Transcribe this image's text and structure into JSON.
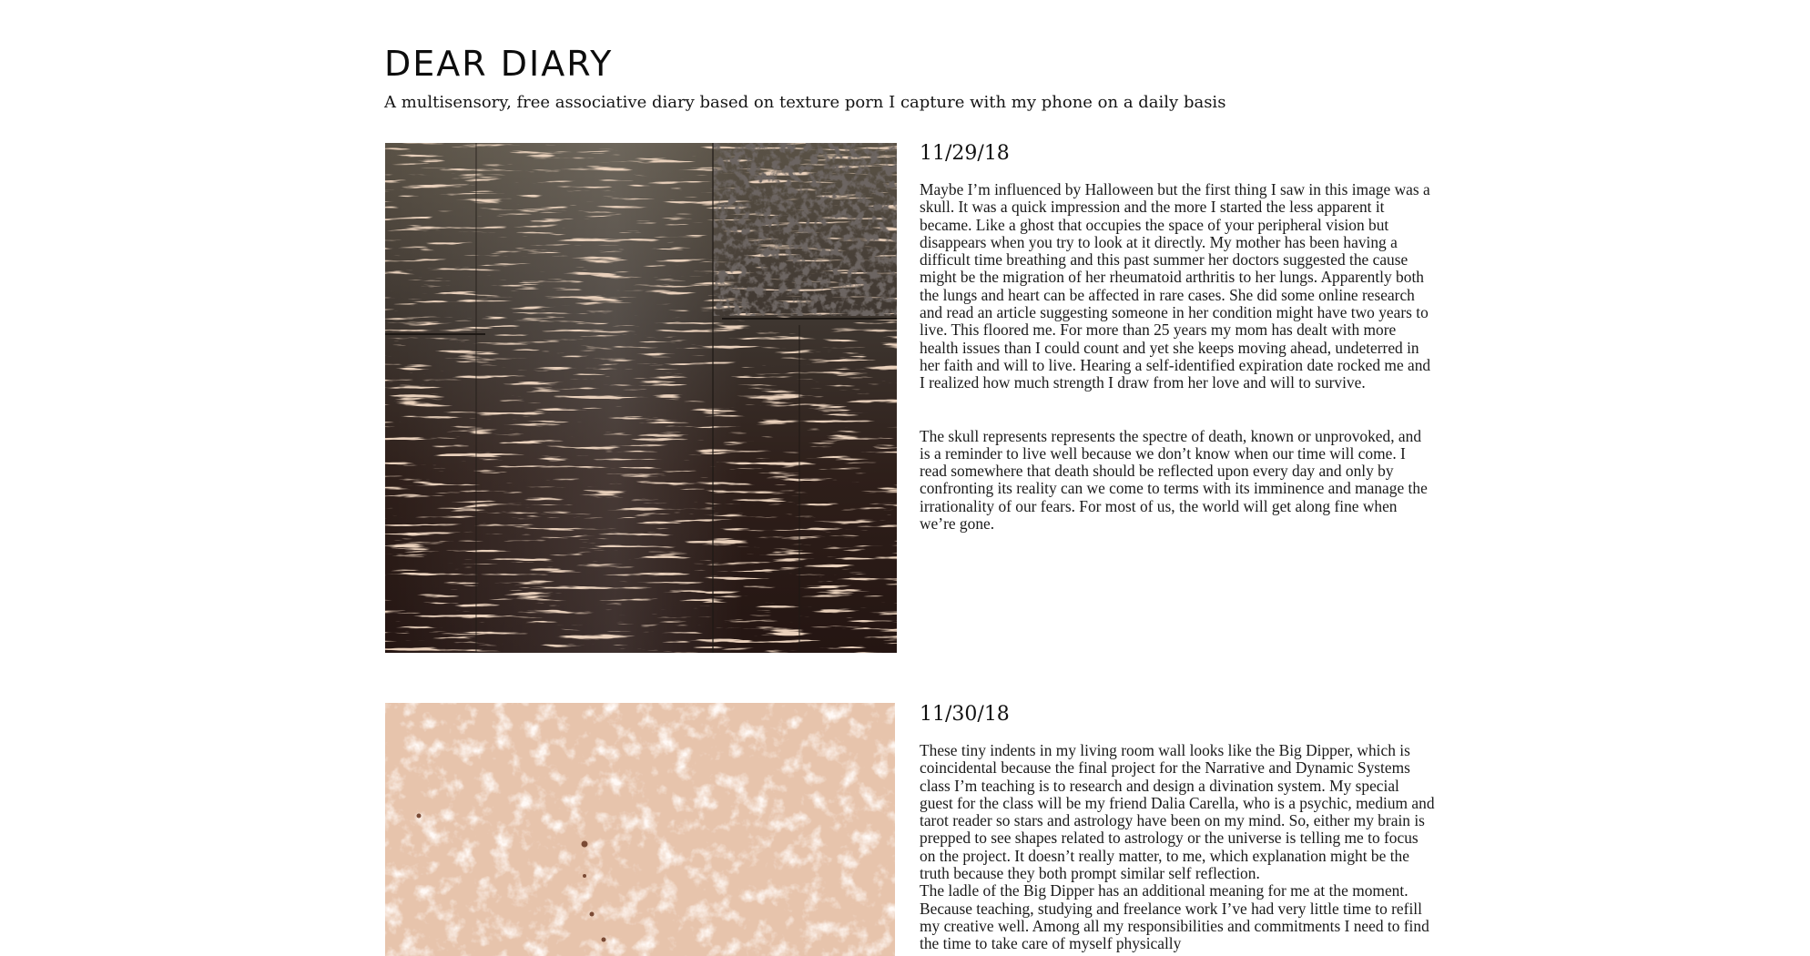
{
  "site": {
    "title": "DEAR DIARY",
    "subtitle": "A multisensory, free associative diary based on texture porn I capture with my phone on a daily basis"
  },
  "entries": [
    {
      "date": "11/29/18",
      "image": "dark-scraped-wood-texture-photo",
      "paragraphs": [
        "Maybe I’m influenced by Halloween but the first thing I saw in this image was a skull. It was a quick impression and the more I started the less ap­parent it became. Like a ghost that occupies the space of your peripheral vision but disappears when you try to look at it directly. My mother has been having a difficult time breathing and this past summer her doctors suggested the cause might be the migration of her rheumatoid arthritis to her lungs. Apparently both the lungs and heart can be affected in rare cases. She did some online research and read an article suggesting someone in her condition might have two years to live. This floored me. For more than 25 years my mom has dealt with more health issues than I could count and yet she keeps moving ahead, undeterred in her faith and will to live. Hearing a self-identified expiration date rocked me and I realized how much strength I draw from her love and will to survive.",
        "The skull represents represents the spectre of death, known or unpro­voked, and is a reminder to live well because we don’t know when our time will come. I read somewhere that death should be reflected upon every day and only by confronting its reality can we come to terms with its imminence and manage the irrationality of our fears. For most of us, the world will get along fine when we’re gone."
      ]
    },
    {
      "date": "11/30/18",
      "image": "beige-textured-wall-photo",
      "paragraphs": [
        "These tiny indents in my living room wall looks like the Big Dipper, which is coincidental because the final project for the Narrative and Dy­namic Systems class I’m teaching is to research and design a divination system. My special guest for the class will be my friend Dalia Carella, who is a psychic, medium and tarot reader so stars and astrology have been on my mind. So, either my brain is prepped to see shapes related to astrology or the universe is telling me to focus on the project. It doesn’t really matter, to me, which  explanation might be the truth because they both prompt similar self reflection.",
        "The ladle of the Big Dipper has an additional meaning for me at the moment. Because teaching, studying and freelance work I’ve had very little time to refill my creative well. Among all my responsibilities and commitments I need to find the time to take care of myself physically"
      ]
    }
  ],
  "colors": {
    "background": "#ffffff",
    "text": "#111111"
  }
}
